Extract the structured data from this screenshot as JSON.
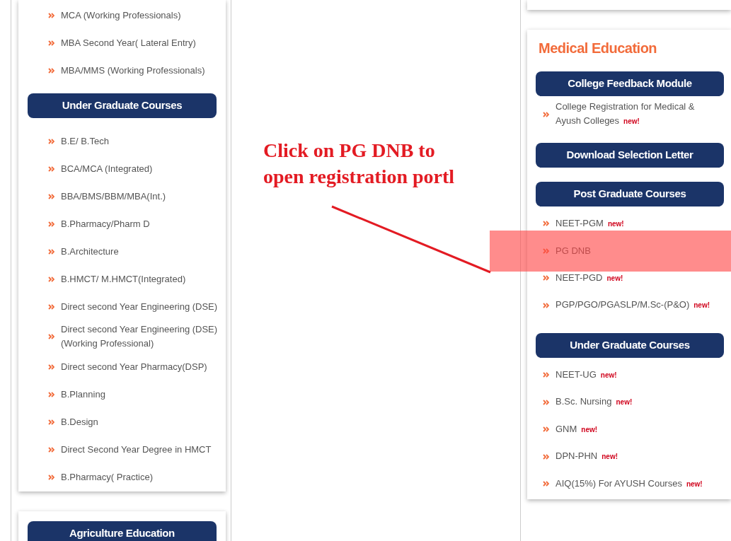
{
  "left_panel": {
    "items_top": [
      {
        "label": "MCA (Working Professionals)"
      },
      {
        "label": "MBA Second Year( Lateral Entry)"
      },
      {
        "label": "MBA/MMS (Working Professionals)"
      }
    ],
    "section": {
      "title": "Under Graduate Courses",
      "items": [
        {
          "label": "B.E/ B.Tech"
        },
        {
          "label": "BCA/MCA (Integrated)"
        },
        {
          "label": "BBA/BMS/BBM/MBA(Int.)"
        },
        {
          "label": "B.Pharmacy/Pharm D"
        },
        {
          "label": "B.Architecture"
        },
        {
          "label": "B.HMCT/ M.HMCT(Integrated)"
        },
        {
          "label": "Direct second Year Engineering (DSE)"
        },
        {
          "label": "Direct second Year Engineering (DSE) (Working Professional)"
        },
        {
          "label": "Direct second Year Pharmacy(DSP)"
        },
        {
          "label": "B.Planning"
        },
        {
          "label": "B.Design"
        },
        {
          "label": "Direct Second Year Degree in HMCT"
        },
        {
          "label": "B.Pharmacy( Practice)"
        }
      ]
    },
    "next_card": {
      "title": "Agriculture Education"
    }
  },
  "right_panel": {
    "title": "Medical Education",
    "sections": [
      {
        "title": "College Feedback Module",
        "items": [
          {
            "label": "College Registration for Medical & Ayush Colleges",
            "badge": "new!",
            "highlighted": false
          }
        ]
      },
      {
        "title": "Download Selection Letter"
      },
      {
        "title": "Post Graduate Courses",
        "items": [
          {
            "label": "NEET-PGM",
            "badge": "new!",
            "highlighted": false
          },
          {
            "label": "PG DNB",
            "highlighted": true
          },
          {
            "label": "NEET-PGD",
            "badge": "new!",
            "highlighted": false
          },
          {
            "label": "PGP/PGO/PGASLP/M.Sc-(P&O)",
            "badge": "new!",
            "highlighted": false
          }
        ]
      },
      {
        "title": "Under Graduate Courses",
        "items": [
          {
            "label": "NEET-UG",
            "badge": "new!",
            "highlighted": false
          },
          {
            "label": "B.Sc. Nursing",
            "badge": "new!",
            "highlighted": false
          },
          {
            "label": "GNM",
            "badge": "new!",
            "highlighted": false
          },
          {
            "label": "DPN-PHN",
            "badge": "new!",
            "highlighted": false
          },
          {
            "label": "AIQ(15%) For AYUSH Courses",
            "badge": "new!",
            "highlighted": false
          }
        ]
      }
    ]
  },
  "annotation": {
    "text": "Click on PG DNB to open registration portl"
  }
}
